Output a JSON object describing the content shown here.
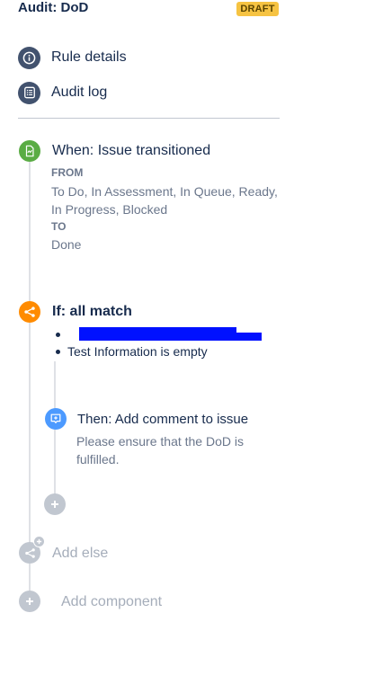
{
  "header": {
    "title": "Audit: DoD",
    "badge": "DRAFT"
  },
  "nav": {
    "items": [
      {
        "label": "Rule details",
        "icon": "info-icon"
      },
      {
        "label": "Audit log",
        "icon": "audit-log-icon"
      }
    ]
  },
  "trigger": {
    "title": "When: Issue transitioned",
    "from_label": "FROM",
    "from_value": "To Do, In Assessment, In Queue, Ready, In Progress, Blocked",
    "to_label": "TO",
    "to_value": "Done",
    "color": "#5aac44"
  },
  "condition": {
    "title": "If: all match",
    "items": [
      "Test Information is empty"
    ],
    "color": "#ff8b00"
  },
  "action": {
    "title": "Then: Add comment to issue",
    "description": "Please ensure that the DoD is fulfilled.",
    "color": "#4c9aff"
  },
  "add_else_label": "Add else",
  "add_component_label": "Add component",
  "colors": {
    "nav_icon_bg": "#42526e",
    "badge_bg": "#f6c342",
    "redaction": "#0011ff"
  }
}
